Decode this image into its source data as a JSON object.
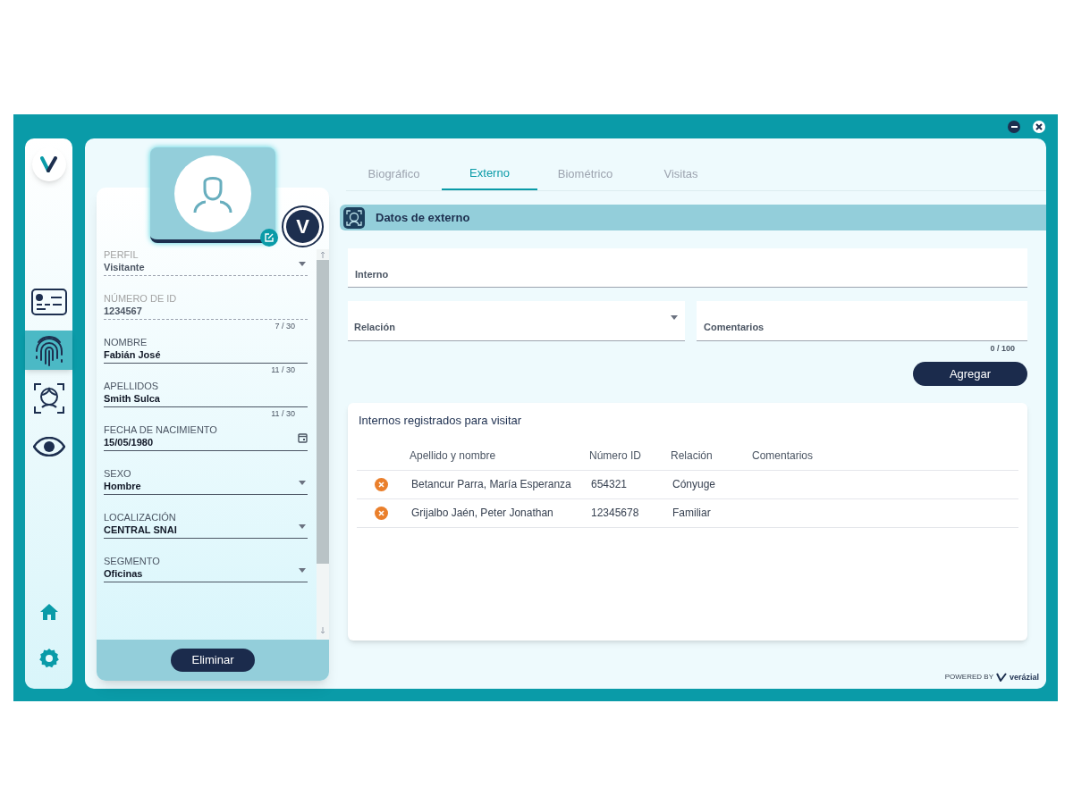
{
  "nav": {
    "items": [
      {
        "kind": "id-card",
        "selected": false
      },
      {
        "kind": "fingerprint",
        "selected": true
      },
      {
        "kind": "face-scan",
        "selected": false
      },
      {
        "kind": "eye",
        "selected": false
      }
    ],
    "bottom": [
      {
        "kind": "home"
      },
      {
        "kind": "settings"
      }
    ]
  },
  "profile": {
    "badge": "V",
    "fields": [
      {
        "kind": "select",
        "label": "PERFIL",
        "value": "Visitante",
        "disabled": true
      },
      {
        "kind": "text",
        "label": "NÚMERO DE ID",
        "value": "1234567",
        "disabled": true,
        "counter": "7 / 30"
      },
      {
        "kind": "text",
        "label": "NOMBRE",
        "value": "Fabián José",
        "disabled": false,
        "counter": "11 / 30"
      },
      {
        "kind": "text",
        "label": "APELLIDOS",
        "value": "Smith Sulca",
        "disabled": false,
        "counter": "11 / 30"
      },
      {
        "kind": "date",
        "label": "FECHA DE NACIMIENTO",
        "value": "15/05/1980",
        "disabled": false
      },
      {
        "kind": "select",
        "label": "SEXO",
        "value": "Hombre",
        "disabled": false
      },
      {
        "kind": "select",
        "label": "LOCALIZACIÓN",
        "value": "CENTRAL SNAI",
        "disabled": false
      },
      {
        "kind": "select",
        "label": "SEGMENTO",
        "value": "Oficinas",
        "disabled": false
      }
    ],
    "delete_button": "Eliminar"
  },
  "tabs": [
    {
      "label": "Biográfico",
      "selected": false
    },
    {
      "label": "Externo",
      "selected": true
    },
    {
      "label": "Biométrico",
      "selected": false
    },
    {
      "label": "Visitas",
      "selected": false
    }
  ],
  "section": {
    "title": "Datos de externo"
  },
  "form": {
    "interno": {
      "label": "Interno"
    },
    "relacion": {
      "label": "Relación"
    },
    "comentarios": {
      "label": "Comentarios",
      "counter": "0 / 100"
    },
    "add_button": "Agregar"
  },
  "table": {
    "title": "Internos registrados para visitar",
    "columns": [
      "Apellido y nombre",
      "Número ID",
      "Relación",
      "Comentarios"
    ],
    "rows": [
      {
        "name": "Betancur Parra, María Esperanza",
        "id": "654321",
        "relation": "Cónyuge"
      },
      {
        "name": "Grijalbo Jaén, Peter Jonathan",
        "id": "12345678",
        "relation": "Familiar"
      }
    ]
  },
  "footer": {
    "powered": "POWERED BY",
    "brand": "verázial"
  }
}
